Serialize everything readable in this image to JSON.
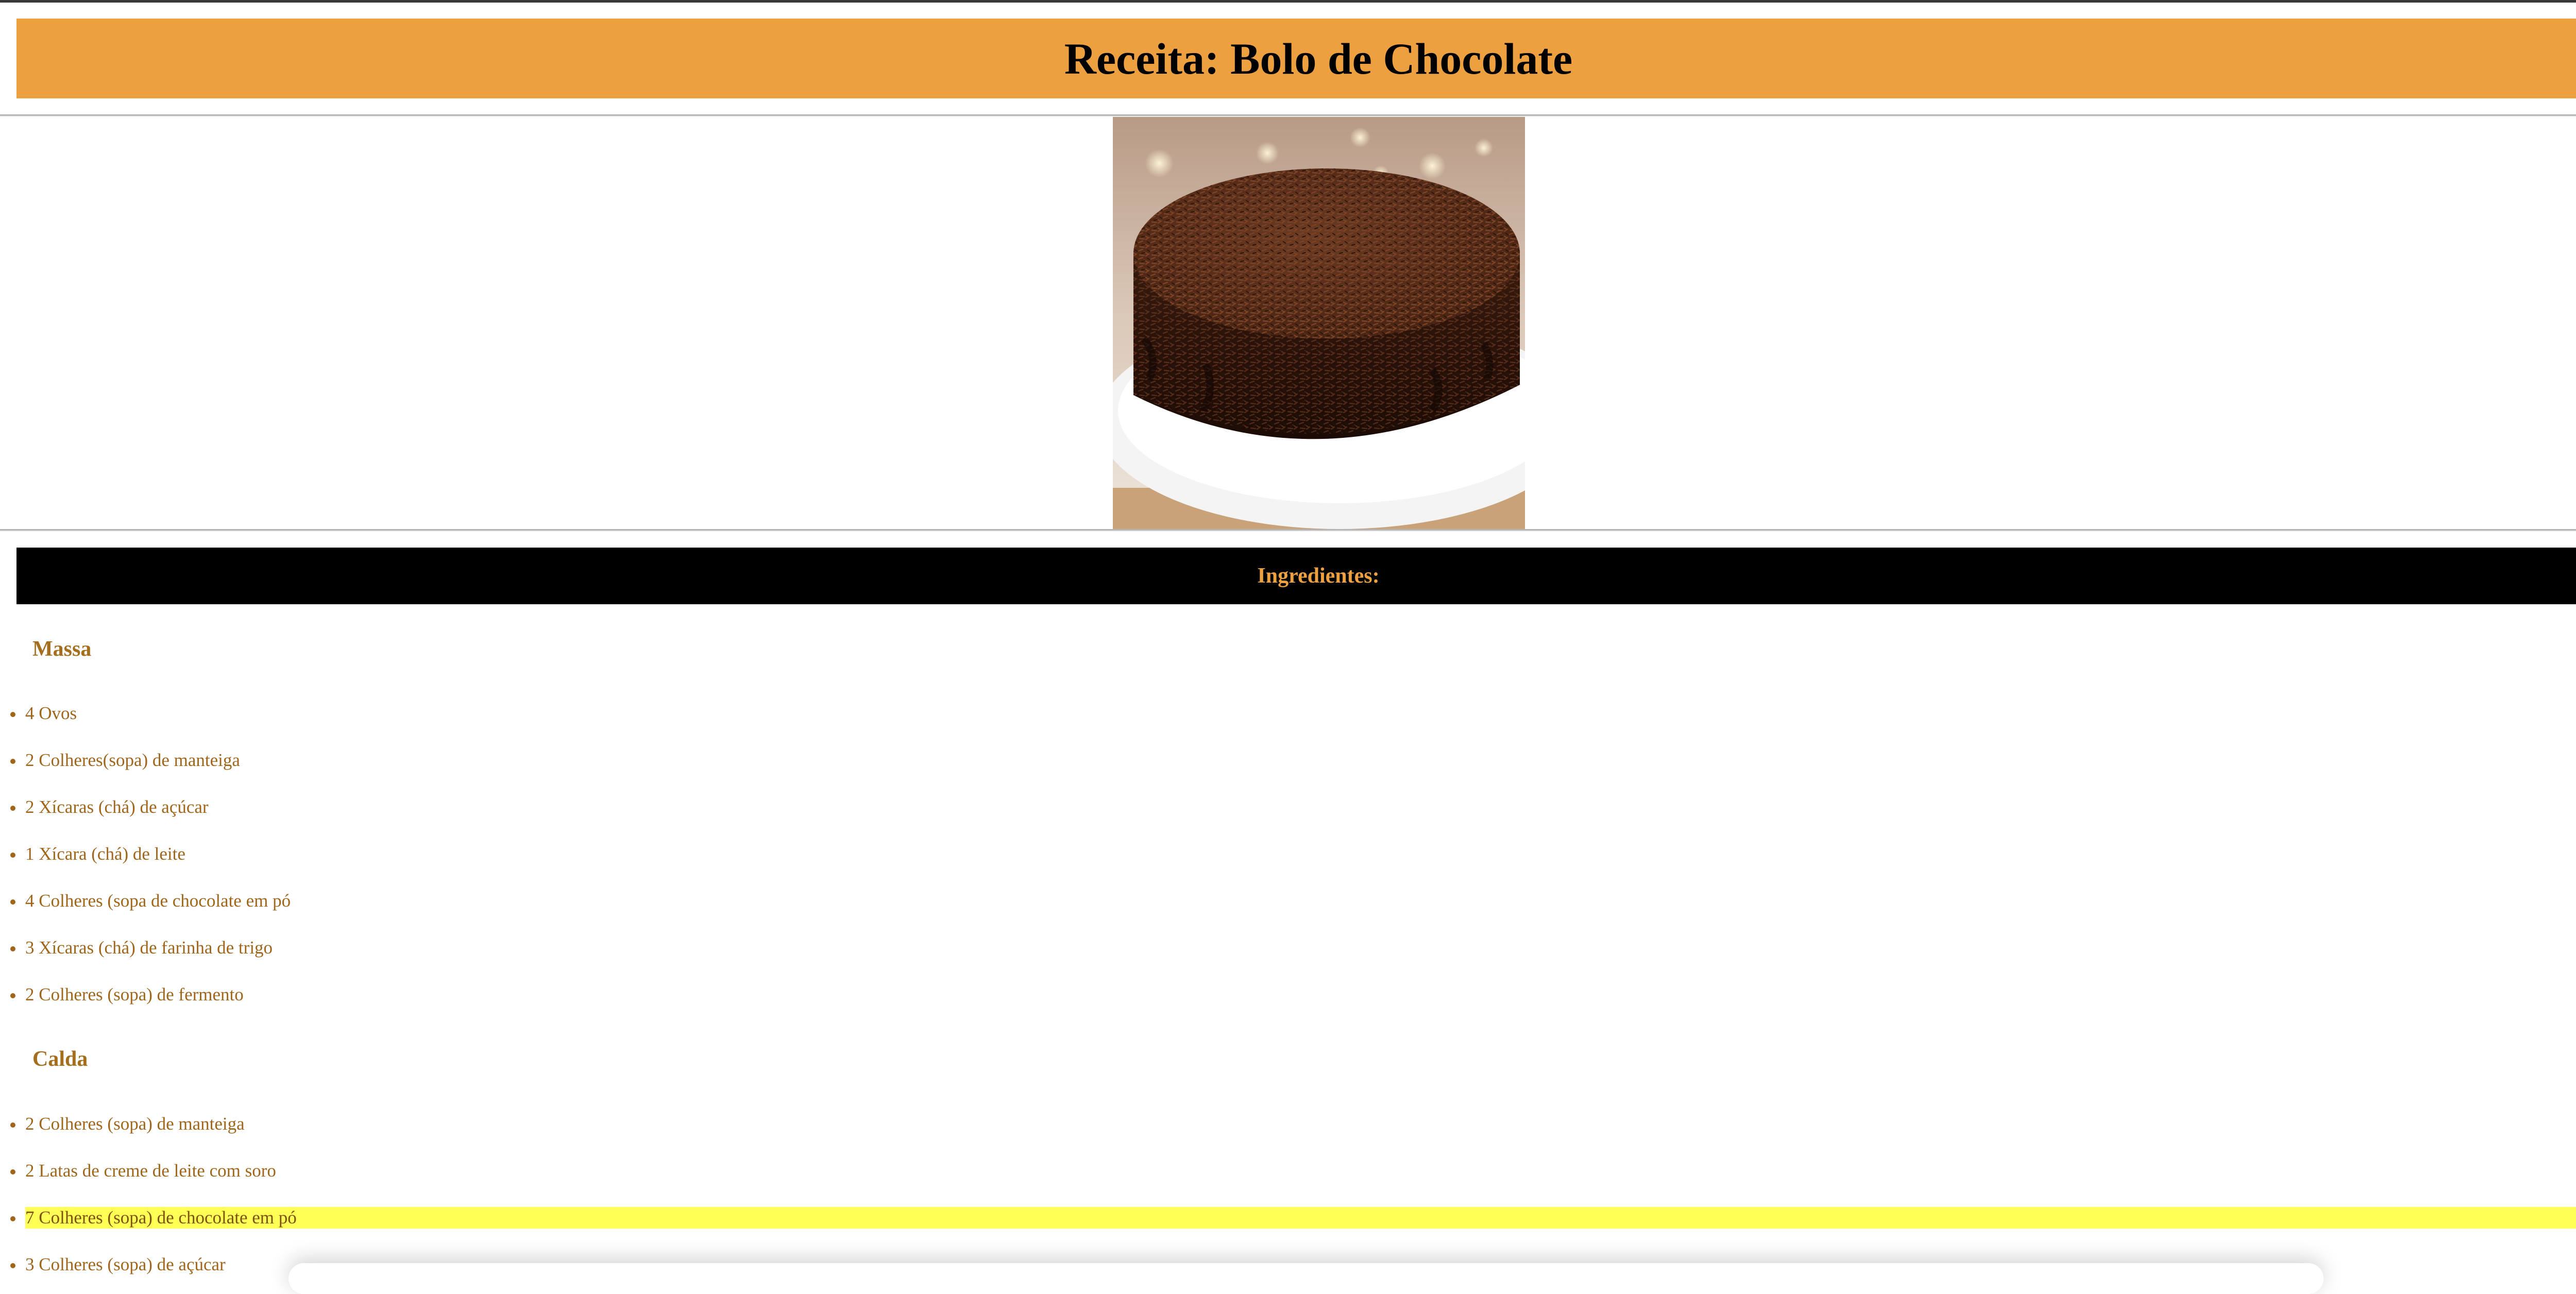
{
  "header": {
    "title": "Receita: Bolo de Chocolate"
  },
  "image": {
    "subject": "chocolate cake with granulated chocolate sprinkles"
  },
  "ingredients": {
    "heading": "Ingredientes:",
    "sections": [
      {
        "title": "Massa",
        "items": [
          "4 Ovos",
          "2 Colheres(sopa) de manteiga",
          "2 Xícaras (chá) de açúcar",
          "1 Xícara (chá) de leite",
          "4 Colheres (sopa de chocolate em pó",
          "3 Xícaras (chá) de farinha de trigo",
          "2 Colheres (sopa) de fermento"
        ]
      },
      {
        "title": "Calda",
        "items": [
          "2 Colheres (sopa) de manteiga",
          "2 Latas de creme de leite com soro",
          "7 Colheres (sopa) de chocolate em pó",
          "3 Colheres (sopa) de açúcar"
        ]
      }
    ]
  },
  "colors": {
    "accent": "#eca040",
    "text": "#a0661b",
    "highlight": "#ffff55"
  }
}
